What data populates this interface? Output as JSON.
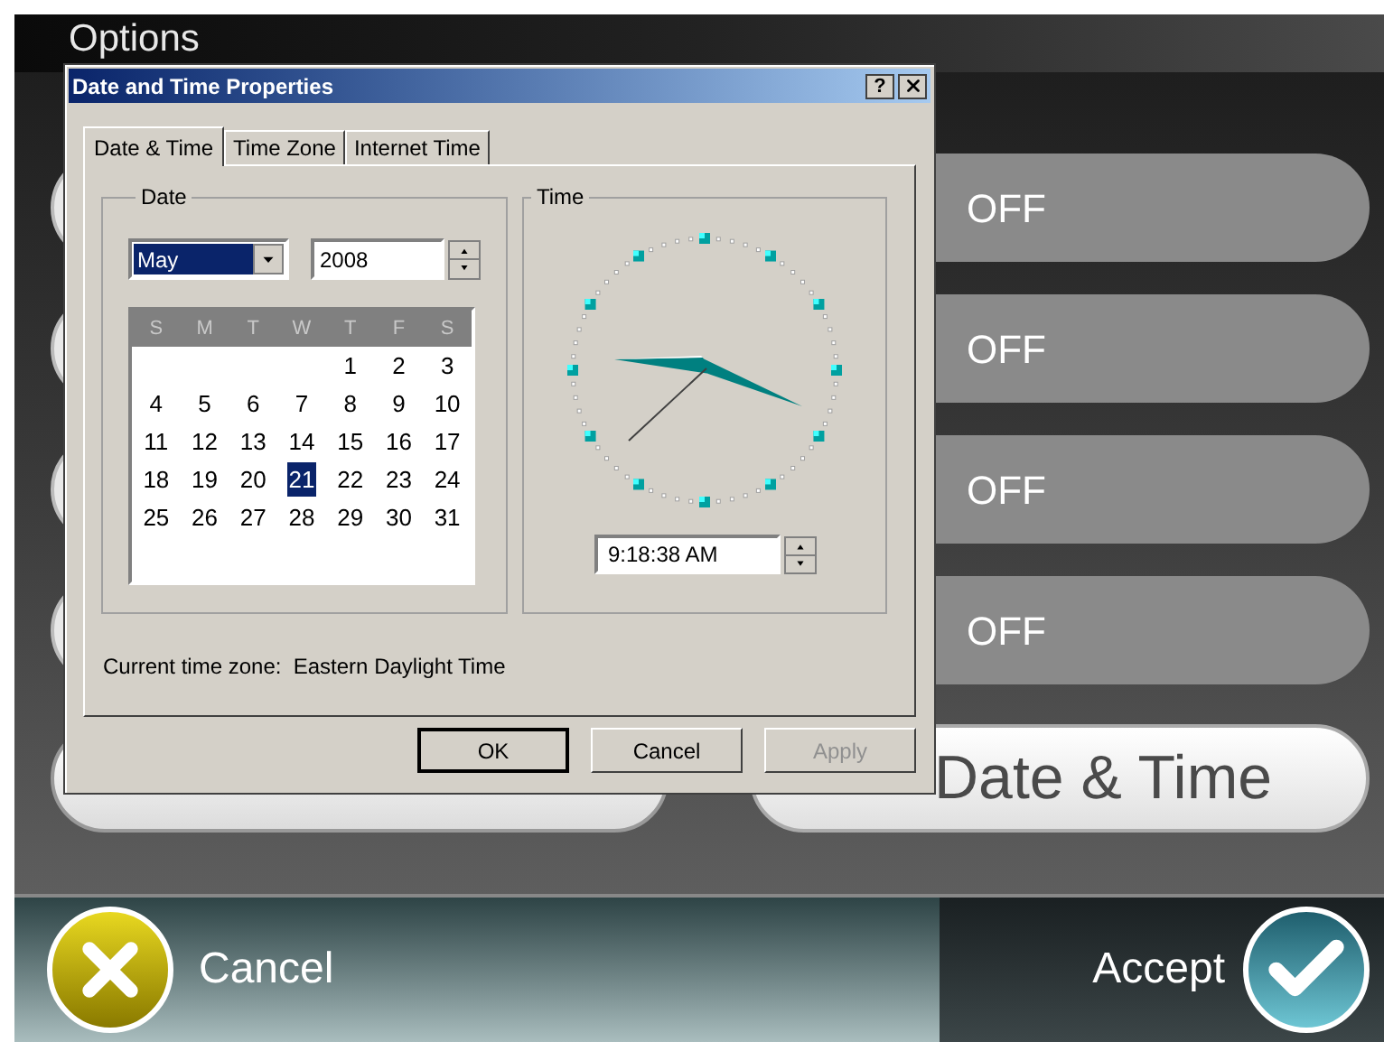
{
  "app": {
    "title": "Options",
    "toggles": [
      {
        "label": "OFF"
      },
      {
        "label": "OFF"
      },
      {
        "label": "OFF"
      },
      {
        "label": "OFF"
      }
    ],
    "date_time_button": "Date & Time"
  },
  "bottom_bar": {
    "cancel": "Cancel",
    "accept": "Accept"
  },
  "dialog": {
    "title": "Date and Time Properties",
    "help_button": "?",
    "tabs": [
      {
        "label": "Date & Time",
        "selected": true
      },
      {
        "label": "Time Zone",
        "selected": false
      },
      {
        "label": "Internet Time",
        "selected": false
      }
    ],
    "date_group": {
      "label": "Date",
      "month": "May",
      "year": "2008",
      "weekdays": [
        "S",
        "M",
        "T",
        "W",
        "T",
        "F",
        "S"
      ],
      "weeks": [
        [
          {
            "day": "1",
            "selected": false
          },
          {
            "day": "2",
            "selected": false
          },
          {
            "day": "3",
            "selected": false
          }
        ],
        [
          {
            "day": "4",
            "selected": false
          },
          {
            "day": "5",
            "selected": false
          },
          {
            "day": "6",
            "selected": false
          },
          {
            "day": "7",
            "selected": false
          },
          {
            "day": "8",
            "selected": false
          },
          {
            "day": "9",
            "selected": false
          },
          {
            "day": "10",
            "selected": false
          }
        ],
        [
          {
            "day": "11",
            "selected": false
          },
          {
            "day": "12",
            "selected": false
          },
          {
            "day": "13",
            "selected": false
          },
          {
            "day": "14",
            "selected": false
          },
          {
            "day": "15",
            "selected": false
          },
          {
            "day": "16",
            "selected": false
          },
          {
            "day": "17",
            "selected": false
          }
        ],
        [
          {
            "day": "18",
            "selected": false
          },
          {
            "day": "19",
            "selected": false
          },
          {
            "day": "20",
            "selected": false
          },
          {
            "day": "21",
            "selected": true
          },
          {
            "day": "22",
            "selected": false
          },
          {
            "day": "23",
            "selected": false
          },
          {
            "day": "24",
            "selected": false
          }
        ],
        [
          {
            "day": "25",
            "selected": false
          },
          {
            "day": "26",
            "selected": false
          },
          {
            "day": "27",
            "selected": false
          },
          {
            "day": "28",
            "selected": false
          },
          {
            "day": "29",
            "selected": false
          },
          {
            "day": "30",
            "selected": false
          },
          {
            "day": "31",
            "selected": false
          }
        ]
      ]
    },
    "time_group": {
      "label": "Time",
      "time": "9:18:38 AM"
    },
    "timezone_text": "Current time zone:  Eastern Daylight Time",
    "buttons": [
      {
        "label": "OK",
        "default": true,
        "disabled": false
      },
      {
        "label": "Cancel",
        "default": false,
        "disabled": false
      },
      {
        "label": "Apply",
        "default": false,
        "disabled": true
      }
    ]
  }
}
